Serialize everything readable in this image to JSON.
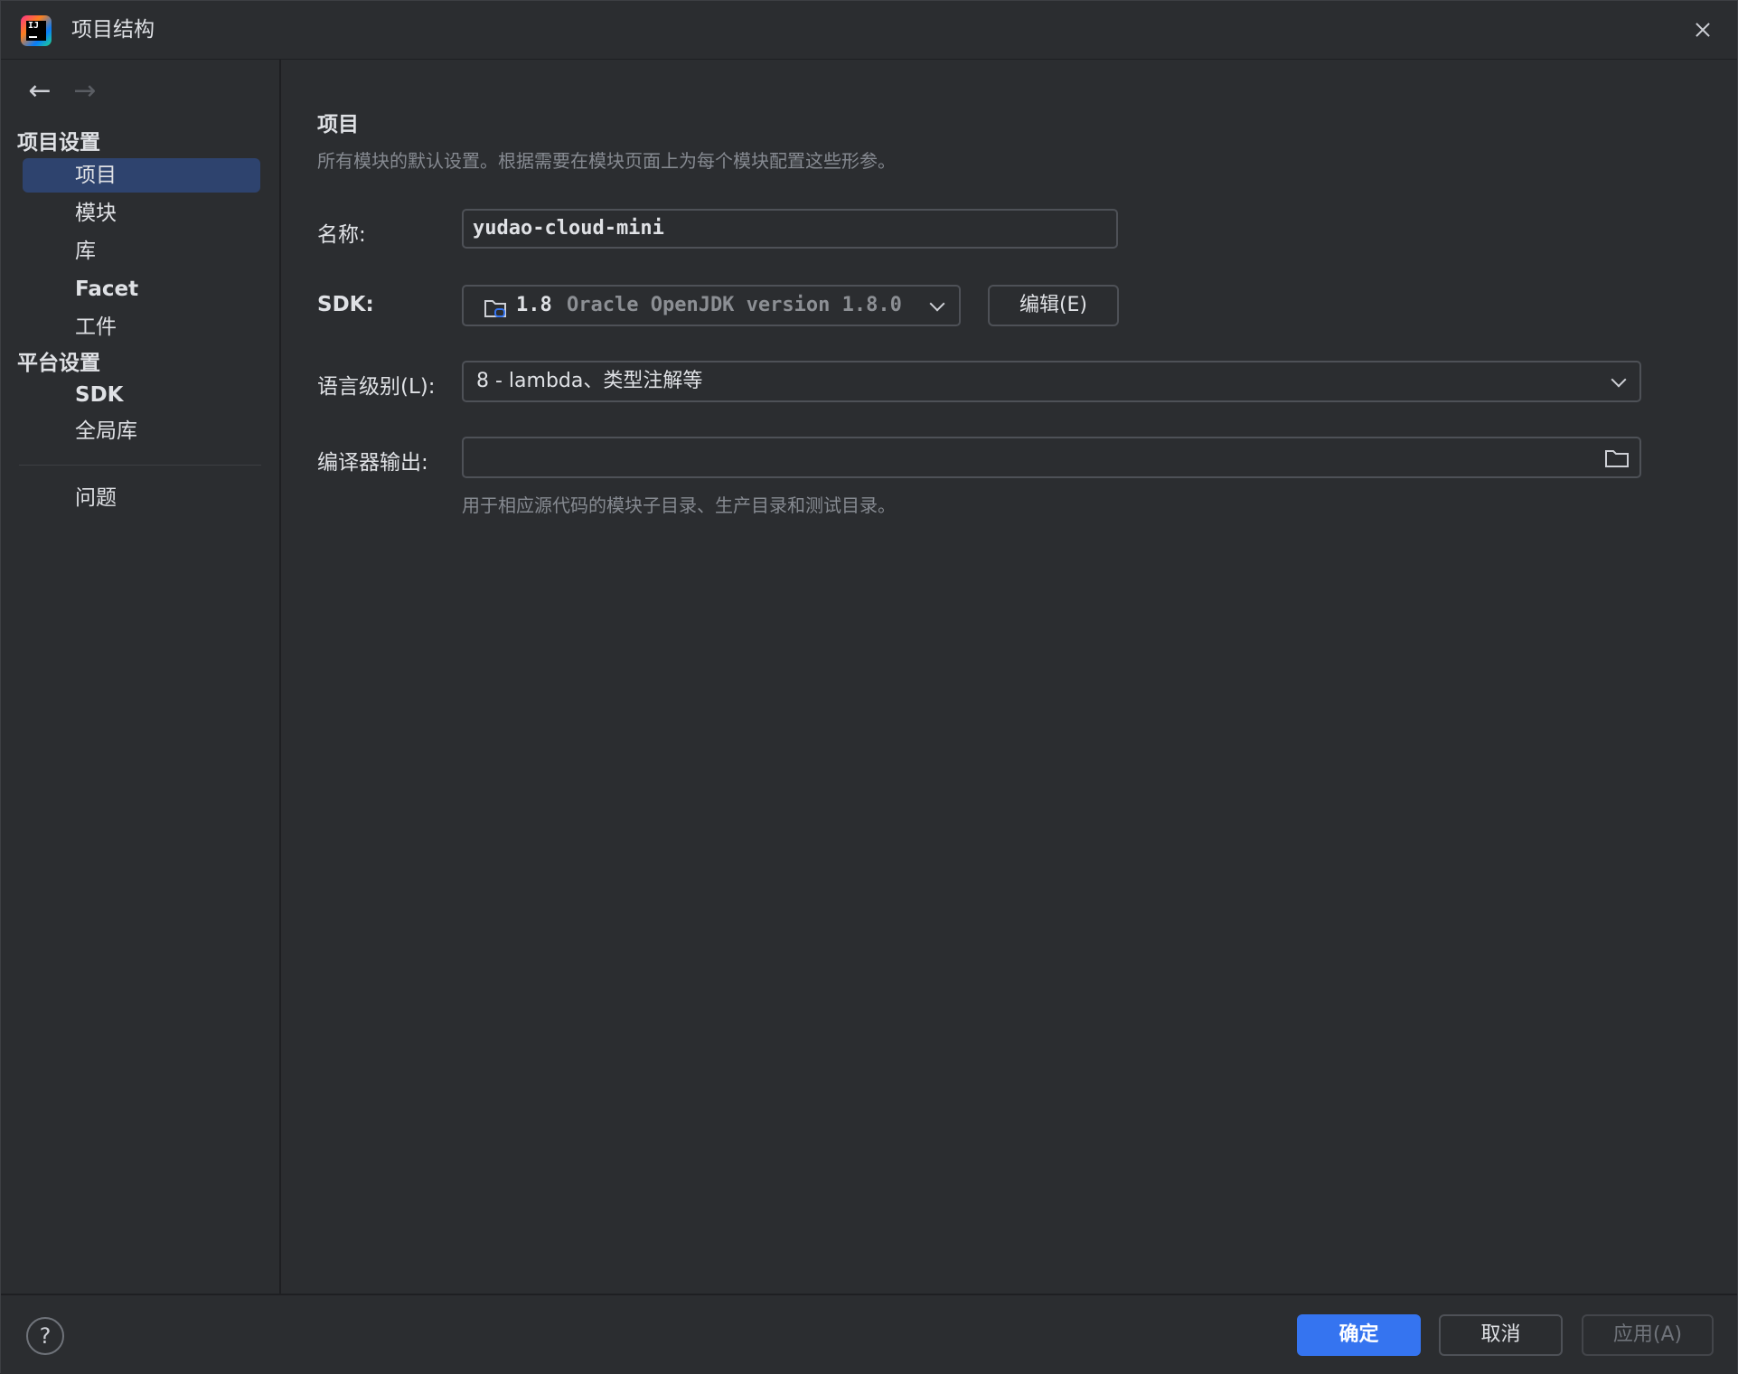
{
  "window": {
    "title": "项目结构"
  },
  "sidebar": {
    "nav_back": "←",
    "nav_forward": "→",
    "project_settings_title": "项目设置",
    "project_items": [
      "项目",
      "模块",
      "库",
      "Facet",
      "工件"
    ],
    "platform_settings_title": "平台设置",
    "platform_items": [
      "SDK",
      "全局库"
    ],
    "problems": "问题"
  },
  "main": {
    "title": "项目",
    "description": "所有模块的默认设置。根据需要在模块页面上为每个模块配置这些形参。",
    "name_label": "名称:",
    "name_value": "yudao-cloud-mini",
    "sdk_label": "SDK:",
    "sdk_version": "1.8",
    "sdk_detail": "Oracle OpenJDK version 1.8.0",
    "edit_button": "编辑(E)",
    "language_level_label": "语言级别(L):",
    "language_level_value": "8 - lambda、类型注解等",
    "compiler_output_label": "编译器输出:",
    "compiler_output_value": "",
    "compiler_output_hint": "用于相应源代码的模块子目录、生产目录和测试目录。"
  },
  "footer": {
    "help": "?",
    "ok": "确定",
    "cancel": "取消",
    "apply": "应用(A)"
  },
  "colors": {
    "background": "#2b2d30",
    "selection": "#2e436e",
    "primary_button": "#3574f0"
  }
}
